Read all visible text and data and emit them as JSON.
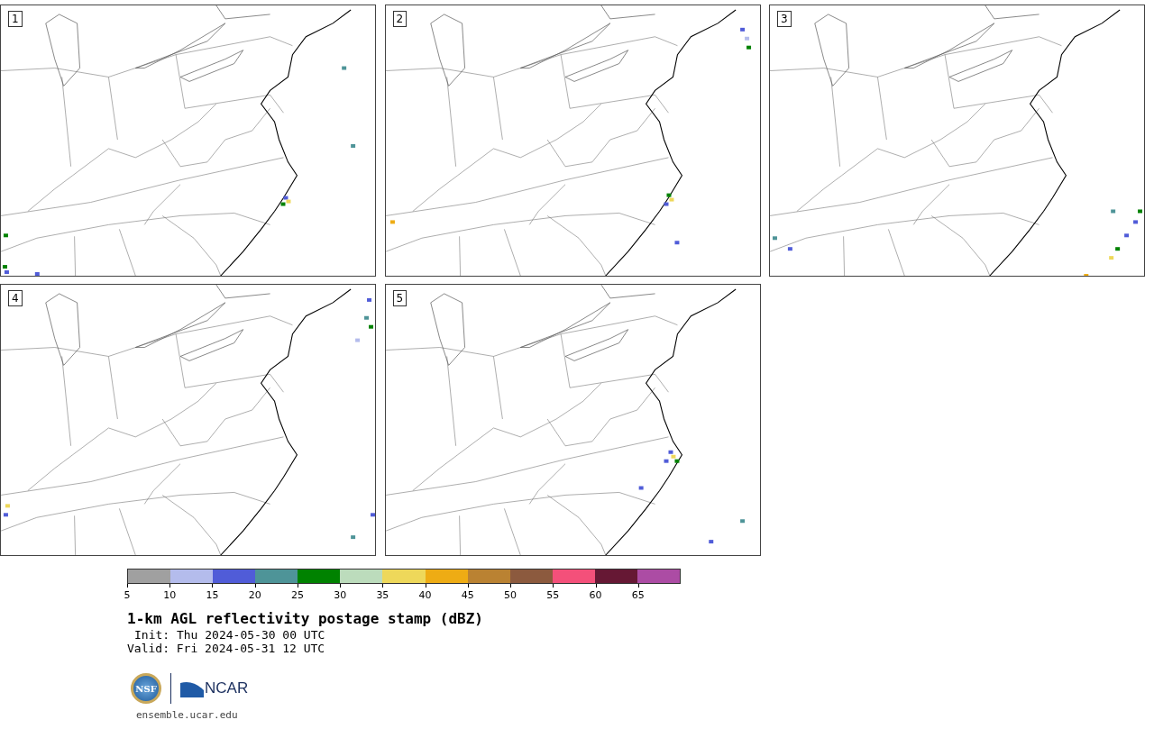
{
  "panels": [
    {
      "label": "1"
    },
    {
      "label": "2"
    },
    {
      "label": "3"
    },
    {
      "label": "4"
    },
    {
      "label": "5"
    }
  ],
  "colorbar": {
    "segments": [
      {
        "color": "#a0a0a0"
      },
      {
        "color": "#b4bcec"
      },
      {
        "color": "#505cd8"
      },
      {
        "color": "#4e9498"
      },
      {
        "color": "#008200"
      },
      {
        "color": "#bcdcbc"
      },
      {
        "color": "#eed85a"
      },
      {
        "color": "#eeac14"
      },
      {
        "color": "#ba8232"
      },
      {
        "color": "#8c5a3e"
      },
      {
        "color": "#f4507a"
      },
      {
        "color": "#661834"
      },
      {
        "color": "#ac4ca4"
      }
    ],
    "ticks": [
      "5",
      "10",
      "15",
      "20",
      "25",
      "30",
      "35",
      "40",
      "45",
      "50",
      "55",
      "60",
      "65"
    ]
  },
  "title": "1-km AGL reflectivity postage stamp (dBZ)",
  "init": "Init: Thu 2024-05-30 00 UTC",
  "valid": "Valid: Fri 2024-05-31 12 UTC",
  "logo": {
    "nsf": "NSF",
    "ncar": "NCAR"
  },
  "site": "ensemble.ucar.edu"
}
